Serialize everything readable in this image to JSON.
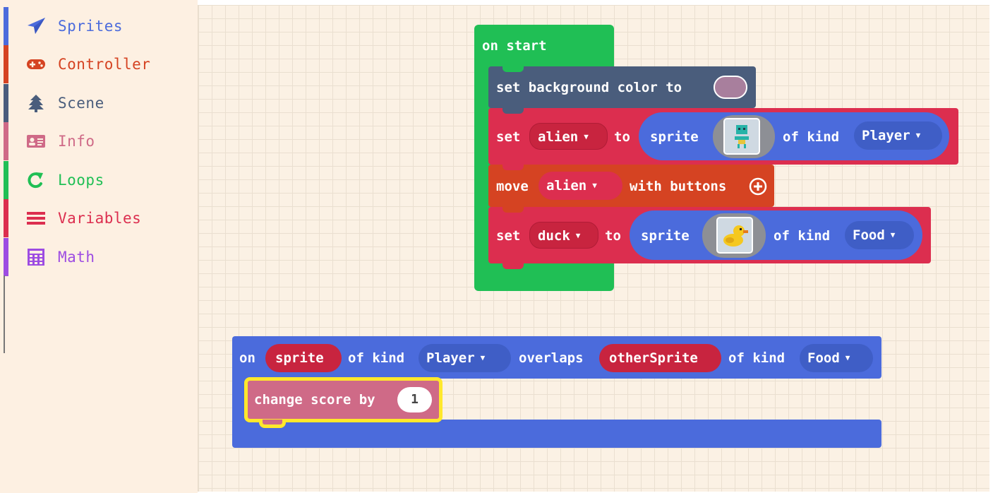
{
  "toolbox": {
    "categories": [
      {
        "label": "Sprites",
        "icon": "paper-plane-icon",
        "color": "#4b6bdc"
      },
      {
        "label": "Controller",
        "icon": "gamepad-icon",
        "color": "#d54322"
      },
      {
        "label": "Scene",
        "icon": "tree-icon",
        "color": "#4a5d7c"
      },
      {
        "label": "Info",
        "icon": "id-card-icon",
        "color": "#cf6a87"
      },
      {
        "label": "Loops",
        "icon": "loop-arrow-icon",
        "color": "#20bf55"
      },
      {
        "label": "Variables",
        "icon": "list-icon",
        "color": "#dc2e4f"
      },
      {
        "label": "Math",
        "icon": "calculator-icon",
        "color": "#9d4ce2"
      }
    ]
  },
  "on_start": {
    "hat_label": "on start",
    "set_bg": {
      "label": "set background color to",
      "color_value": "#a87f9d"
    },
    "set_alien": {
      "set": "set",
      "var": "alien",
      "to": "to",
      "sprite": "sprite",
      "of_kind": "of kind",
      "kind": "Player",
      "image": "alien-sprite-image"
    },
    "move_alien": {
      "move": "move",
      "var": "alien",
      "with": "with buttons",
      "expand_icon": "plus-circle-icon"
    },
    "set_duck": {
      "set": "set",
      "var": "duck",
      "to": "to",
      "sprite": "sprite",
      "of_kind": "of kind",
      "kind": "Food",
      "image": "duck-sprite-image"
    }
  },
  "overlap_event": {
    "on": "on",
    "param1": "sprite",
    "of_kind1": "of kind",
    "kind1": "Player",
    "overlaps": "overlaps",
    "param2": "otherSprite",
    "of_kind2": "of kind",
    "kind2": "Food",
    "change_score": {
      "label": "change score by",
      "value": "1"
    }
  },
  "colors": {
    "loops": "#20bf55",
    "scene": "#4a5d7c",
    "variables": "#dc2e4f",
    "controller": "#d54322",
    "sprites": "#4b6bdc",
    "info": "#cf6a87",
    "highlight": "#ffe82b"
  }
}
